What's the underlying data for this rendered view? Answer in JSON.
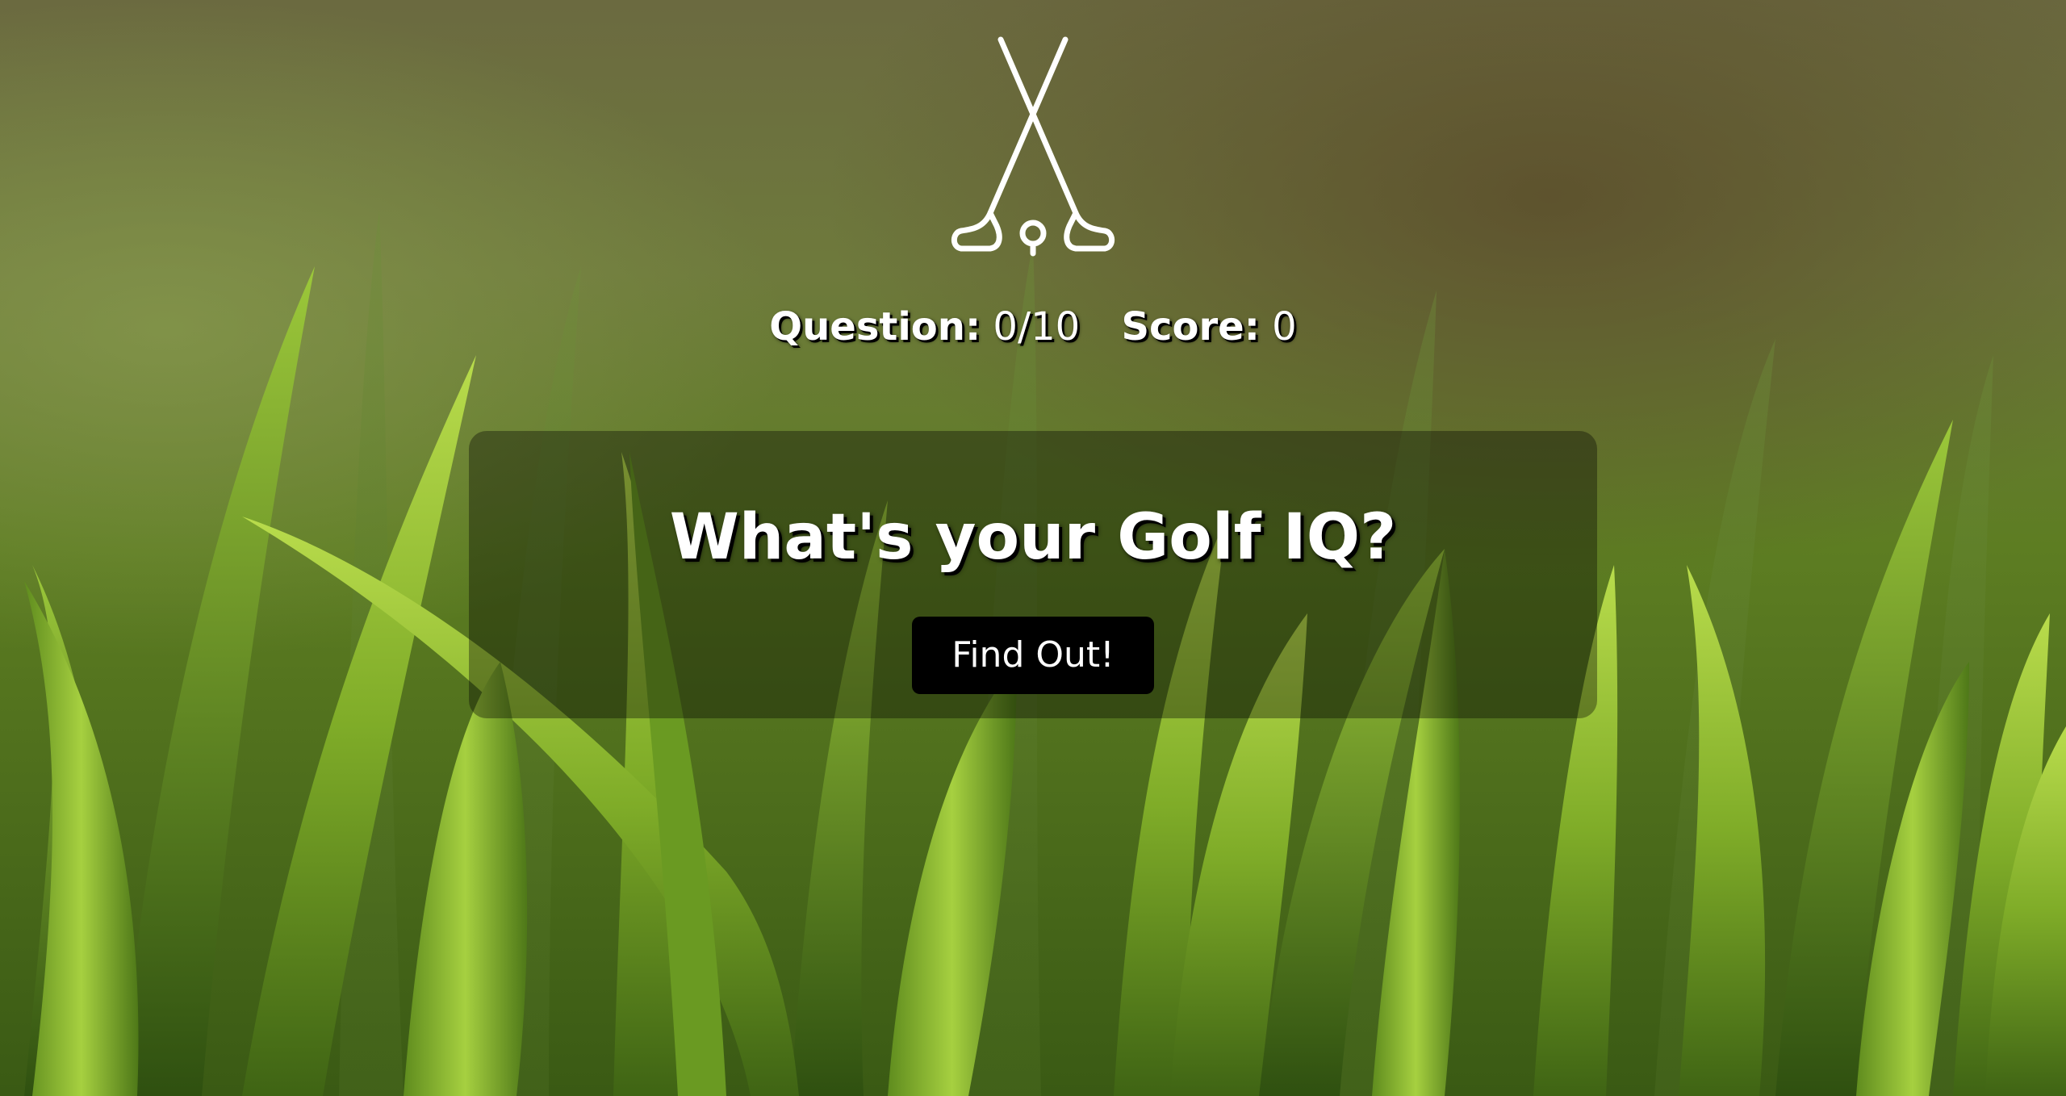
{
  "quiz": {
    "question_label": "Question:",
    "question_value": "0/10",
    "score_label": "Score:",
    "score_value": "0"
  },
  "intro": {
    "heading": "What's your Golf IQ?",
    "button_label": "Find Out!"
  },
  "logo": {
    "icon": "golf-clubs-icon"
  },
  "colors": {
    "panel_bg": "rgba(0,0,0,0.35)",
    "button_bg": "#000000",
    "text": "#ffffff",
    "grass_dark": "#2f4a10",
    "grass_light": "#a8cc3a"
  }
}
